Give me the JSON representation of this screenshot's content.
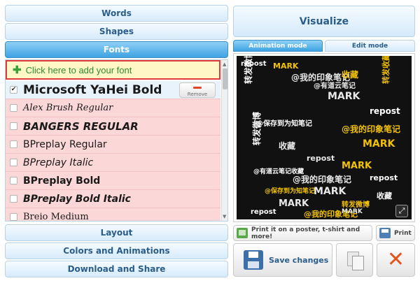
{
  "left_nav": {
    "words": "Words",
    "shapes": "Shapes",
    "fonts": "Fonts",
    "layout": "Layout",
    "colors": "Colors and Animations",
    "download": "Download and Share"
  },
  "fonts_panel": {
    "add_font": "Click here to add your font",
    "remove_label": "Remove",
    "fonts": [
      {
        "name": "Microsoft YaHei Bold",
        "checked": true
      },
      {
        "name": "Alex Brush Regular",
        "checked": false
      },
      {
        "name": "BANGERS REGULAR",
        "checked": false
      },
      {
        "name": "BPreplay Regular",
        "checked": false
      },
      {
        "name": "BPreplay Italic",
        "checked": false
      },
      {
        "name": "BPreplay Bold",
        "checked": false
      },
      {
        "name": "BPreplay Bold Italic",
        "checked": false
      },
      {
        "name": "Breio Medium",
        "checked": false
      }
    ]
  },
  "right_panel": {
    "visualize": "Visualize",
    "tab_animation": "Animation mode",
    "tab_edit": "Edit mode",
    "print_poster": "Print it on a poster, t-shirt and more!",
    "print": "Print",
    "save": "Save changes"
  },
  "word_cloud": {
    "words": [
      "repost",
      "MARK",
      "@我的印象笔记",
      "转发微博",
      "收藏",
      "@有道云笔记",
      "@保存到为知笔记",
      "转发收藏",
      "MARK",
      "repost",
      "@我的印象笔记",
      "收藏",
      "转发微博",
      "MARK",
      "repost",
      "@有道云笔记收藏",
      "MARK",
      "@我的印象笔记",
      "repost",
      "@保存到为知笔记",
      "MARK",
      "收藏",
      "转发微博",
      "MARK",
      "repost",
      "@我的印象笔记",
      "MARK"
    ],
    "colors": [
      "#ffffff",
      "#f2c200",
      "#e8e8e8"
    ]
  },
  "colors": {
    "accent": "#3ea3e2",
    "highlight_border": "#e03a3a",
    "delete": "#e5531d"
  }
}
